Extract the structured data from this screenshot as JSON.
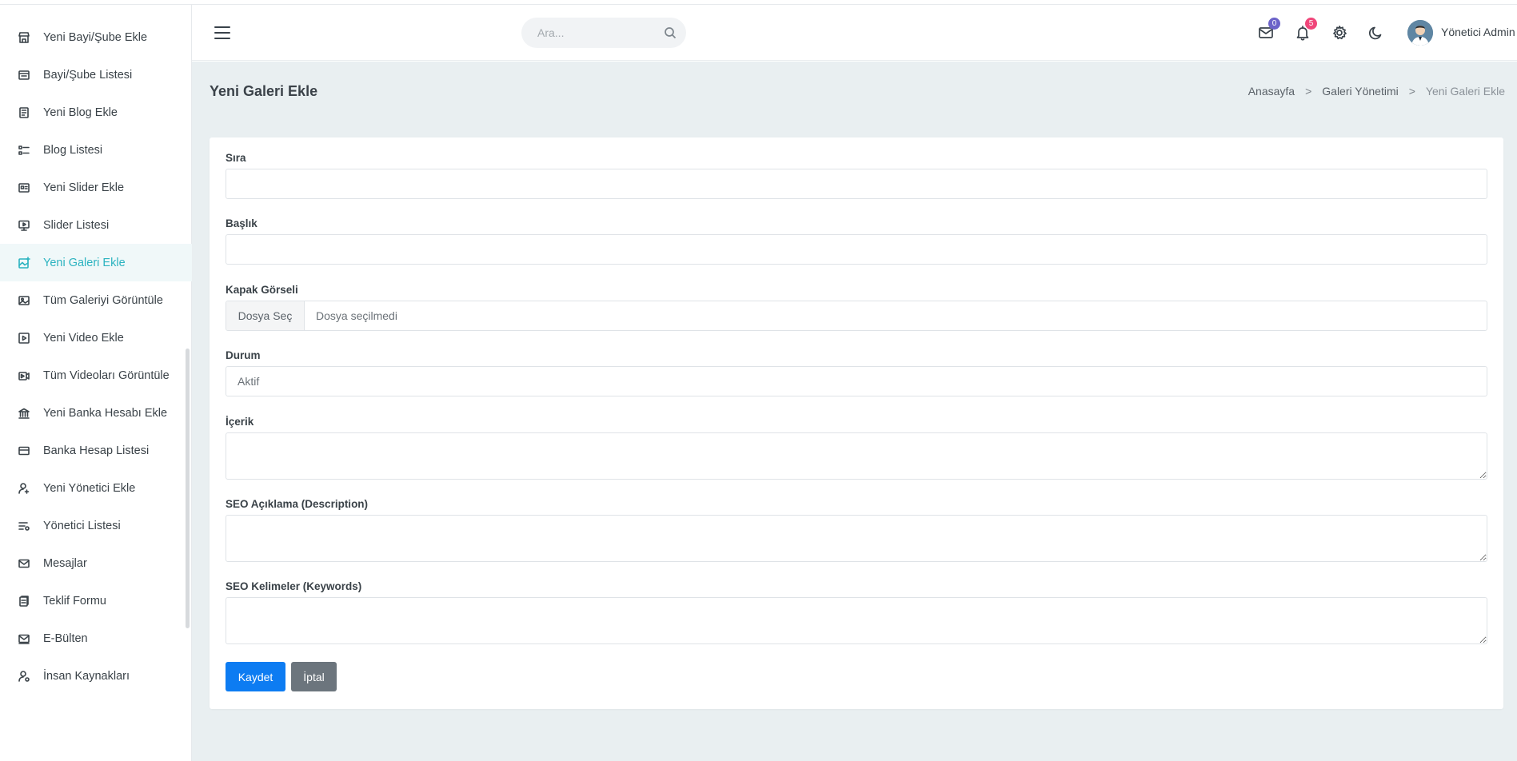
{
  "sidebar": {
    "items": [
      {
        "label": "Yeni Bayi/Şube Ekle",
        "icon": "store-icon"
      },
      {
        "label": "Bayi/Şube Listesi",
        "icon": "store-list-icon"
      },
      {
        "label": "Yeni Blog Ekle",
        "icon": "document-icon"
      },
      {
        "label": "Blog Listesi",
        "icon": "list-icon"
      },
      {
        "label": "Yeni Slider Ekle",
        "icon": "slider-icon"
      },
      {
        "label": "Slider Listesi",
        "icon": "monitor-icon"
      },
      {
        "label": "Yeni Galeri Ekle",
        "icon": "gallery-add-icon",
        "active": true
      },
      {
        "label": "Tüm Galeriyi Görüntüle",
        "icon": "image-icon"
      },
      {
        "label": "Yeni Video Ekle",
        "icon": "video-icon"
      },
      {
        "label": "Tüm Videoları Görüntüle",
        "icon": "video-list-icon"
      },
      {
        "label": "Yeni Banka Hesabı Ekle",
        "icon": "bank-icon"
      },
      {
        "label": "Banka Hesap Listesi",
        "icon": "credit-card-icon"
      },
      {
        "label": "Yeni Yönetici Ekle",
        "icon": "user-add-icon"
      },
      {
        "label": "Yönetici Listesi",
        "icon": "user-list-icon"
      },
      {
        "label": "Mesajlar",
        "icon": "mail-icon"
      },
      {
        "label": "Teklif Formu",
        "icon": "form-icon"
      },
      {
        "label": "E-Bülten",
        "icon": "newsletter-icon"
      },
      {
        "label": "İnsan Kaynakları",
        "icon": "hr-icon"
      }
    ]
  },
  "header": {
    "search_placeholder": "Ara...",
    "mail_count": "0",
    "notification_count": "5",
    "user_name": "Yönetici Admin",
    "colors": {
      "mail_badge": "#6c63c9",
      "notification_badge": "#f0467a"
    }
  },
  "page": {
    "title": "Yeni Galeri Ekle",
    "breadcrumb": [
      "Anasayfa",
      "Galeri Yönetimi",
      "Yeni Galeri Ekle"
    ]
  },
  "form": {
    "order_label": "Sıra",
    "title_label": "Başlık",
    "cover_label": "Kapak Görseli",
    "file_button": "Dosya Seç",
    "file_status": "Dosya seçilmedi",
    "status_label": "Durum",
    "status_value": "Aktif",
    "content_label": "İçerik",
    "seo_desc_label": "SEO Açıklama (Description)",
    "seo_keywords_label": "SEO Kelimeler (Keywords)",
    "save_label": "Kaydet",
    "cancel_label": "İptal"
  },
  "colors": {
    "accent": "#2bb3c0",
    "primary_button": "#0d7cf2",
    "secondary_button": "#6c757d",
    "background": "#e9eff1"
  }
}
